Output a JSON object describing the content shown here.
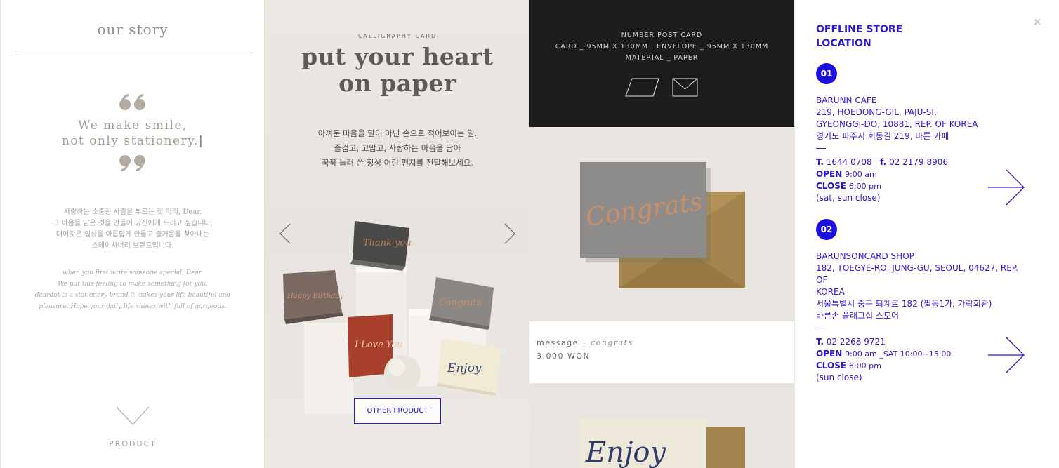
{
  "story": {
    "title": "our story",
    "tagline_1": "We make smile,",
    "tagline_2": "not only stationery.",
    "ko": [
      "사랑하는 소중한 사람을 부르는 첫 머리, Dear.",
      "그 마음을 담은 것을 만들어 당신에게 드리고 싶습니다.",
      "더어맞은 일상을 아름답게 만들고 즐거움을 찾아내는",
      "스테이셔너리 브랜드입니다."
    ],
    "en": [
      "when you first write someone special, Dear.",
      "We put this feeling to make something for you.",
      "deardot is a stationery brand it makes your life beautiful and",
      "pleasure. Hope your daily life shines with full of gorgeous."
    ],
    "product_label": "PRODUCT"
  },
  "calligraphy": {
    "kicker": "CALLIGRAPHY CARD",
    "headline_1": "put your heart",
    "headline_2": "on paper",
    "desc": [
      "아껴둔 마음을 말이 아닌 손으로 적어보이는 일.",
      "즐겁고, 고맙고, 사랑하는 마음을 담아",
      "꾹꾹 눌러 쓴 정성 어린 편지를 전달해보세요."
    ],
    "button": "OTHER PRODUCT",
    "cards": [
      "Thank you",
      "Happy Birthday",
      "Congrats",
      "I Love You",
      "Enjoy"
    ]
  },
  "postcard": {
    "spec": [
      "NUMBER POST CARD",
      "CARD _ 95MM X 130MM , ENVELOPE _ 95MM X 130MM",
      "MATERIAL _ PAPER"
    ],
    "card_text": "Congrats",
    "card_text_2": "Enjoy",
    "product_name": "message _",
    "product_variant": "congrats",
    "price": "3,000 WON"
  },
  "offline": {
    "title_1": "OFFLINE STORE",
    "title_2": "LOCATION",
    "close": "×",
    "stores": [
      {
        "num": "01",
        "name": "BARUNN CAFE",
        "addr": [
          "219, HOEDONG-GIL, PAJU-SI,",
          "GYEONGGI-DO, 10881, REP. OF KOREA",
          "경기도 파주시 회동길 219, 바른 카페"
        ],
        "tel": "1644 0708",
        "fax": "02 2179 8906",
        "open": "9:00 am",
        "close": "6:00 pm",
        "note": "(sat, sun close)"
      },
      {
        "num": "02",
        "name": "BARUNSONCARD SHOP",
        "addr": [
          "182, TOEGYE-RO, JUNG-GU, SEOUL, 04627, REP. OF",
          "KOREA",
          "서울특별시 중구 퇴계로 182 (필동1가, 가락회관)",
          "바른손 플래그십 스토어"
        ],
        "tel": "02 2268 9721",
        "open": "9:00 am _SAT 10:00~15:00",
        "close": "6:00 pm",
        "note": "(sun close)"
      }
    ],
    "labels": {
      "t": "T.",
      "f": "f.",
      "open": "OPEN",
      "close": "CLOSE"
    }
  }
}
